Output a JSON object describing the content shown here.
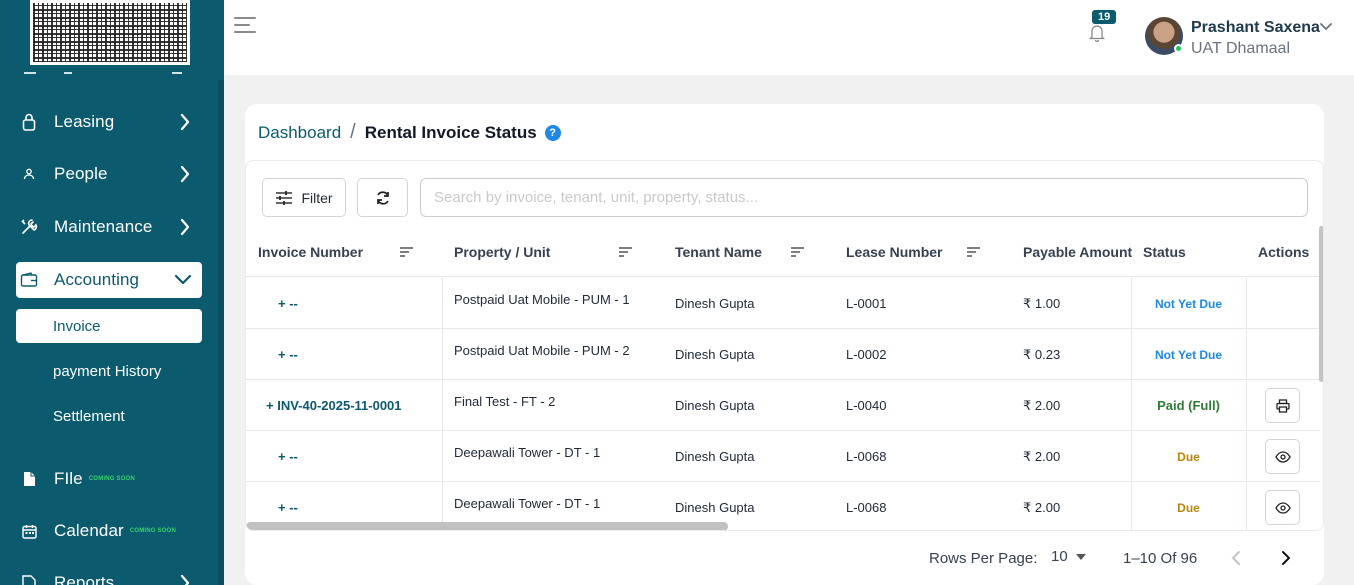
{
  "sidebar": {
    "items": [
      {
        "label": "Leasing",
        "icon": "document-lock-icon"
      },
      {
        "label": "People",
        "icon": "person-icon"
      },
      {
        "label": "Maintenance",
        "icon": "tools-icon"
      },
      {
        "label": "Accounting",
        "icon": "wallet-icon"
      },
      {
        "label": "FIle",
        "icon": "file-icon",
        "badge": "COMING SOON"
      },
      {
        "label": "Calendar",
        "icon": "calendar-icon",
        "badge": "COMING SOON"
      },
      {
        "label": "Reports",
        "icon": "report-icon"
      }
    ],
    "accounting_sub": [
      {
        "label": "Invoice"
      },
      {
        "label": "payment History"
      },
      {
        "label": "Settlement"
      }
    ],
    "colors": {
      "background": "#0b5a6e",
      "coming_soon": "#39d36a"
    }
  },
  "header": {
    "notification_count": "19",
    "user_name": "Prashant Saxena",
    "user_org": "UAT Dhamaal"
  },
  "breadcrumb": {
    "parent": "Dashboard",
    "separator": "/",
    "current": "Rental Invoice Status",
    "help": "?"
  },
  "toolbar": {
    "filter_label": "Filter",
    "search_placeholder": "Search by invoice, tenant, unit, property, status..."
  },
  "table": {
    "columns": [
      "Invoice Number",
      "Property / Unit",
      "Tenant Name",
      "Lease Number",
      "Payable Amount",
      "Status",
      "Actions"
    ],
    "rows": [
      {
        "invoice": "+ --",
        "property": "Postpaid Uat Mobile - PUM - 1",
        "tenant": "Dinesh Gupta",
        "lease": "L-0001",
        "amount": "₹ 1.00",
        "status": "Not Yet Due",
        "status_type": "nyd",
        "action": ""
      },
      {
        "invoice": "+ --",
        "property": "Postpaid Uat Mobile - PUM - 2",
        "tenant": "Dinesh Gupta",
        "lease": "L-0002",
        "amount": "₹ 0.23",
        "status": "Not Yet Due",
        "status_type": "nyd",
        "action": ""
      },
      {
        "invoice": "+ INV-40-2025-11-0001",
        "property": "Final Test - FT - 2",
        "tenant": "Dinesh Gupta",
        "lease": "L-0040",
        "amount": "₹ 2.00",
        "status": "Paid (Full)",
        "status_type": "paid",
        "action": "print-icon"
      },
      {
        "invoice": "+ --",
        "property": "Deepawali Tower - DT - 1",
        "tenant": "Dinesh Gupta",
        "lease": "L-0068",
        "amount": "₹ 2.00",
        "status": "Due",
        "status_type": "due",
        "action": "eye-icon"
      },
      {
        "invoice": "+ --",
        "property": "Deepawali Tower - DT - 1",
        "tenant": "Dinesh Gupta",
        "lease": "L-0068",
        "amount": "₹ 2.00",
        "status": "Due",
        "status_type": "due",
        "action": "eye-icon"
      }
    ],
    "status_colors": {
      "nyd": "#1e88e5",
      "paid": "#2e7d32",
      "due": "#b8860b"
    }
  },
  "pagination": {
    "rows_per_page_label": "Rows Per Page:",
    "rows_per_page": "10",
    "range": "1–10 Of 96"
  }
}
